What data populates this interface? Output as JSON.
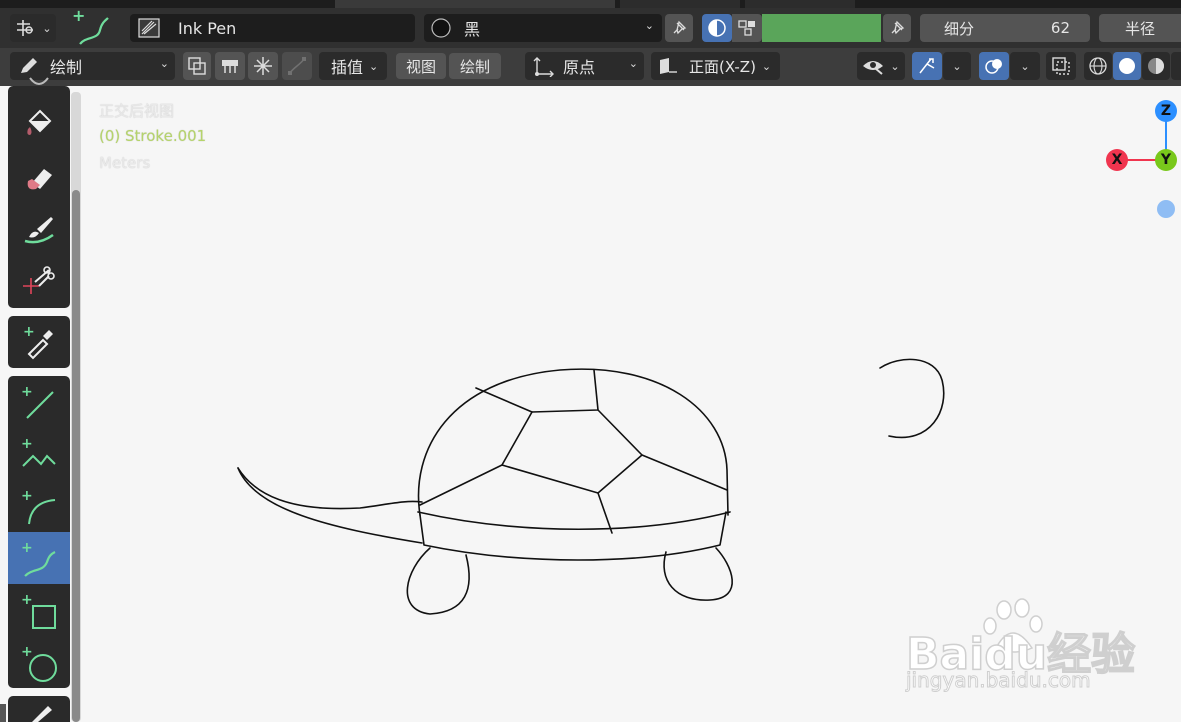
{
  "header": {
    "brush_name": "Ink Pen",
    "material_name": "黑",
    "subdivide_label": "细分",
    "subdivide_value": "62",
    "radius_label": "半径"
  },
  "toolbar2": {
    "mode_label": "绘制",
    "interpolate_label": "插值",
    "view_menu": "视图",
    "draw_menu": "绘制",
    "origin_label": "原点",
    "plane_label": "正面(X-Z)"
  },
  "viewport": {
    "view_name": "正交后视图",
    "object_name": "(0) Stroke.001",
    "units": "Meters",
    "gizmo": {
      "z": "Z",
      "x": "X",
      "y": "Y"
    },
    "watermark_main": "Baidu经验",
    "watermark_sub": "jingyan.baidu.com"
  },
  "colors": {
    "accent": "#4772b3",
    "material_color": "#5aa55a",
    "axis_x": "#f0354f",
    "axis_y": "#79c81b",
    "axis_z": "#2c8fff"
  }
}
